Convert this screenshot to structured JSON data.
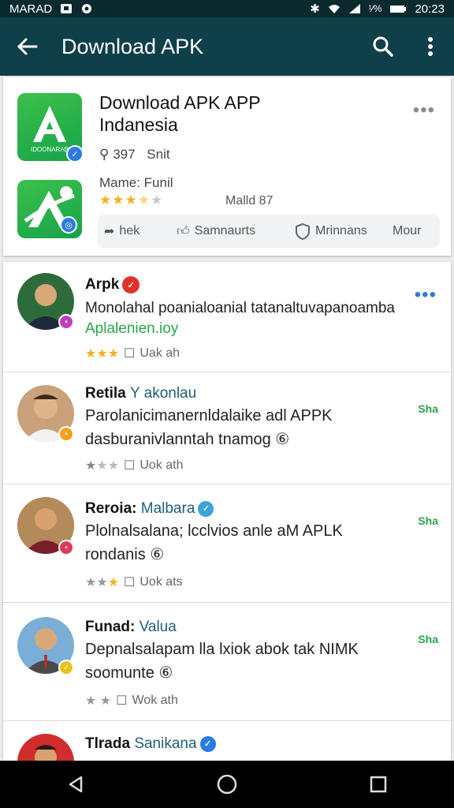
{
  "status": {
    "carrier": "MARAD",
    "battery": "¹⁄%",
    "time": "20:23"
  },
  "appbar": {
    "title": "Download APK"
  },
  "app_card": {
    "title": "Download APK APP\nIndanesia",
    "icon_label": "IDOONARAB",
    "downloads": "397",
    "downloads_suffix": "Snit",
    "meta": "Mame: Funil",
    "rating_stars": 3.5,
    "meta_right": "Malld 87",
    "actions": [
      {
        "label": "hek",
        "icon": "share-icon"
      },
      {
        "label": "Samnaurts",
        "icon": "thumbs-up-icon"
      },
      {
        "label": "Mrinnans",
        "icon": "shield-icon"
      },
      {
        "label": "Mour",
        "icon": "more-icon"
      }
    ]
  },
  "posts": [
    {
      "name": "Arpk",
      "text_line1": "Monolahal poanialoanial tatanaltuvapanoamba",
      "text_line2": "Aplalenien.ioy",
      "stars": 3,
      "meta": "Uak ah",
      "avatar_color": "#2e6b3a",
      "badge_color": "#c13fbf"
    },
    {
      "name": "Retila",
      "name_sub": "Y akonlau",
      "text": "Parolanicimanernldalaike adl APPK\ndasburanivlanntah tnamog ⑥",
      "stars": 1.5,
      "meta": "Uok ath",
      "side": "Sha",
      "avatar_color": "#c9a17a",
      "badge_color": "#f2a21f"
    },
    {
      "name": "Reroia:",
      "name_sub": "Malbara",
      "text": "Plolnalsalana; lcclvios anle aM APLK\nrondanis ⑥",
      "stars": 2.5,
      "meta": "Uok ats",
      "side": "Sha",
      "avatar_color": "#7a2a2a",
      "badge_color": "#e03a5a"
    },
    {
      "name": "Funad:",
      "name_sub": "Valua",
      "text": "Depnalsalapam lla lxiok abok tak NIMK\nsoomunte ⑥",
      "stars": 2,
      "meta": "Wok ath",
      "side": "Sha",
      "avatar_color": "#7aaed6",
      "badge_color": "#e9c21a"
    },
    {
      "name": "Tlrada",
      "name_sub": "Sanikana",
      "avatar_color": "#d12d2d"
    }
  ]
}
